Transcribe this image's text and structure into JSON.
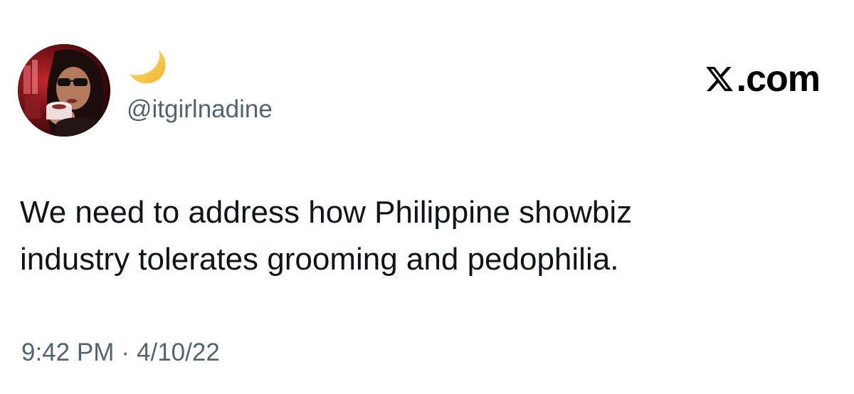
{
  "tweet": {
    "author": {
      "display_name_icon": "crescent-moon-emoji",
      "handle": "@itgirlnadine"
    },
    "brand": {
      "text": ".com",
      "logo_icon": "x-logo-icon"
    },
    "text_lines": [
      "We need to address how Philippine showbiz",
      "industry tolerates grooming and pedophilia."
    ],
    "time": "9:42 PM",
    "separator": "·",
    "date": "4/10/22"
  },
  "colors": {
    "text_primary": "#0f1419",
    "text_secondary": "#536471",
    "moon": "#f5c542",
    "background": "#ffffff"
  }
}
